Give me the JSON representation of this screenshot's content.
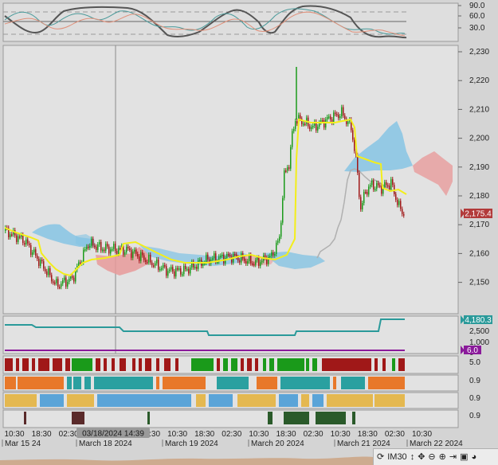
{
  "colors": {
    "price_badge": "#b23a3a",
    "vol_badge": "#2a9a9a",
    "osc_badge": "#8a1a9a",
    "bull": "#1a9a1a",
    "bear": "#a01818",
    "kijun": "#f3ee1a"
  },
  "stoch_axis": [
    "90.0",
    "60.0",
    "30.0"
  ],
  "price_axis": [
    "2,230",
    "2,220",
    "2,210",
    "2,200",
    "2,190",
    "2,180",
    "2,170",
    "2,160",
    "2,150"
  ],
  "price_badge": "2,175.4",
  "vol_axis": [
    "2,500",
    "1,000",
    "0"
  ],
  "vol_badge": "4,180.3",
  "osc_badge": "6.0",
  "strip_labels": [
    "5.0",
    "0.9",
    "0.9",
    "0.9"
  ],
  "time_labels": [
    "10:30",
    "18:30",
    "02:30",
    "10:30",
    "18:30",
    "02:30",
    "10:30",
    "18:30",
    "02:30",
    "10:30",
    "18:30",
    "02:30",
    "10:30",
    "18:30",
    "02:30",
    "10:30"
  ],
  "date_labels": [
    "Mar 15 24",
    "March 18 2024",
    "March 19 2024",
    "March 20 2024",
    "March 21 2024",
    "March 22 2024"
  ],
  "crosshair_label": "03/18/2024 14:39",
  "toolbar": {
    "interval": "IM30",
    "icons": [
      "sync-icon",
      "resize-vertical-icon",
      "move-icon",
      "zoom-out-icon",
      "zoom-in-icon",
      "scroll-right-icon",
      "window-icon",
      "palette-icon"
    ]
  }
}
